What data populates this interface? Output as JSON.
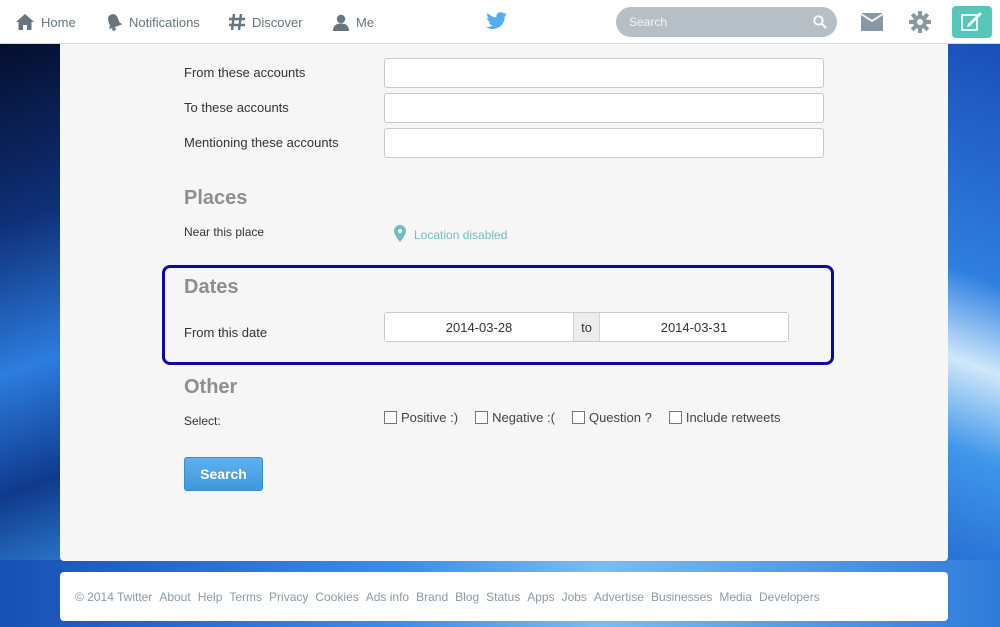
{
  "nav": {
    "home": "Home",
    "notifications": "Notifications",
    "discover": "Discover",
    "me": "Me"
  },
  "search": {
    "placeholder": "Search"
  },
  "form": {
    "from_accounts_label": "From these accounts",
    "to_accounts_label": "To these accounts",
    "mentioning_label": "Mentioning these accounts",
    "places_title": "Places",
    "near_place_label": "Near this place",
    "location_status": "Location disabled",
    "dates_title": "Dates",
    "from_date_label": "From this date",
    "from_date_value": "2014-03-28",
    "date_separator": "to",
    "to_date_value": "2014-03-31",
    "other_title": "Other",
    "select_label": "Select:",
    "options": [
      {
        "label": "Positive :)",
        "checked": false
      },
      {
        "label": "Negative :(",
        "checked": false
      },
      {
        "label": "Question ?",
        "checked": false
      },
      {
        "label": "Include retweets",
        "checked": false
      }
    ],
    "search_button": "Search"
  },
  "footer": {
    "copyright": "© 2014 Twitter",
    "links": [
      "About",
      "Help",
      "Terms",
      "Privacy",
      "Cookies",
      "Ads info",
      "Brand",
      "Blog",
      "Status",
      "Apps",
      "Jobs",
      "Advertise",
      "Businesses",
      "Media",
      "Developers"
    ]
  },
  "colors": {
    "accent": "#55acee",
    "location": "#6ec0bc",
    "highlight": "#0a0a9e",
    "compose": "#55c6b8"
  },
  "icons": {
    "home": "home-icon",
    "notifications": "bell-icon",
    "discover": "hashtag-icon",
    "me": "person-icon",
    "logo": "twitter-bird-icon",
    "search": "magnifier-icon",
    "messages": "envelope-icon",
    "settings": "gear-icon",
    "compose": "compose-icon",
    "location": "map-pin-icon"
  }
}
